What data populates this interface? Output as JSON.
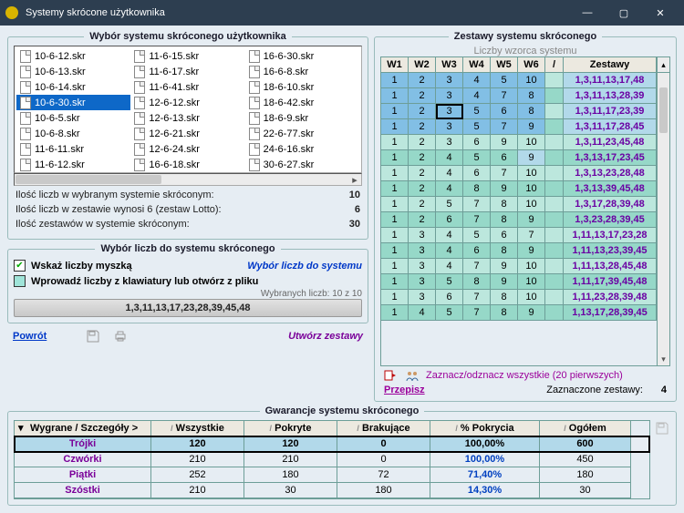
{
  "window": {
    "title": "Systemy skrócone użytkownika"
  },
  "left": {
    "legend": "Wybór systemu skróconego użytkownika",
    "files": [
      "10-6-12.skr",
      "11-6-15.skr",
      "16-6-30.skr",
      "10-6-13.skr",
      "11-6-17.skr",
      "16-6-8.skr",
      "10-6-14.skr",
      "11-6-41.skr",
      "18-6-10.skr",
      "10-6-30.skr",
      "12-6-12.skr",
      "18-6-42.skr",
      "10-6-5.skr",
      "12-6-13.skr",
      "18-6-9.skr",
      "10-6-8.skr",
      "12-6-21.skr",
      "22-6-77.skr",
      "11-6-11.skr",
      "12-6-24.skr",
      "24-6-16.skr",
      "11-6-12.skr",
      "16-6-18.skr",
      "30-6-27.skr"
    ],
    "selected_file": "10-6-30.skr",
    "info": [
      {
        "label": "Ilość liczb w wybranym systemie skróconym:",
        "value": "10"
      },
      {
        "label": "Ilość liczb w zestawie wynosi 6 (zestaw Lotto):",
        "value": "6"
      },
      {
        "label": "Ilość zestawów w systemie skróconym:",
        "value": "30"
      }
    ]
  },
  "picker": {
    "legend": "Wybór liczb do systemu skróconego",
    "opt_mouse": "Wskaż liczby myszką",
    "opt_link": "Wybór liczb do systemu",
    "opt_file": "Wprowadź liczby z klawiatury lub otwórz z pliku",
    "chosen_label": "Wybranych liczb: 10 z 10",
    "chosen_numbers": "1,3,11,13,17,23,28,39,45,48"
  },
  "actions": {
    "back": "Powrót",
    "create": "Utwórz zestawy"
  },
  "sets": {
    "legend": "Zestawy systemu skróconego",
    "pattern": "Liczby wzorca systemu",
    "headers": [
      "W1",
      "W2",
      "W3",
      "W4",
      "W5",
      "W6",
      "/",
      "Zestawy"
    ],
    "rows": [
      {
        "w": [
          1,
          2,
          3,
          4,
          5,
          10
        ],
        "z": "1,3,11,13,17,48",
        "sel": true
      },
      {
        "w": [
          1,
          2,
          3,
          4,
          7,
          8
        ],
        "z": "1,3,11,13,28,39",
        "sel": true
      },
      {
        "w": [
          1,
          2,
          3,
          5,
          6,
          8
        ],
        "z": "1,3,11,17,23,39",
        "sel": true,
        "box": 2
      },
      {
        "w": [
          1,
          2,
          3,
          5,
          7,
          9
        ],
        "z": "1,3,11,17,28,45",
        "sel": true
      },
      {
        "w": [
          1,
          2,
          3,
          6,
          9,
          10
        ],
        "z": "1,3,11,23,45,48"
      },
      {
        "w": [
          1,
          2,
          4,
          5,
          6,
          9
        ],
        "z": "1,3,13,17,23,45",
        "cellsel": 5
      },
      {
        "w": [
          1,
          2,
          4,
          6,
          7,
          10
        ],
        "z": "1,3,13,23,28,48"
      },
      {
        "w": [
          1,
          2,
          4,
          8,
          9,
          10
        ],
        "z": "1,3,13,39,45,48"
      },
      {
        "w": [
          1,
          2,
          5,
          7,
          8,
          10
        ],
        "z": "1,3,17,28,39,48"
      },
      {
        "w": [
          1,
          2,
          6,
          7,
          8,
          9
        ],
        "z": "1,3,23,28,39,45"
      },
      {
        "w": [
          1,
          3,
          4,
          5,
          6,
          7
        ],
        "z": "1,11,13,17,23,28"
      },
      {
        "w": [
          1,
          3,
          4,
          6,
          8,
          9
        ],
        "z": "1,11,13,23,39,45"
      },
      {
        "w": [
          1,
          3,
          4,
          7,
          9,
          10
        ],
        "z": "1,11,13,28,45,48"
      },
      {
        "w": [
          1,
          3,
          5,
          8,
          9,
          10
        ],
        "z": "1,11,17,39,45,48"
      },
      {
        "w": [
          1,
          3,
          6,
          7,
          8,
          10
        ],
        "z": "1,11,23,28,39,48"
      },
      {
        "w": [
          1,
          4,
          5,
          7,
          8,
          9
        ],
        "z": "1,13,17,28,39,45"
      }
    ],
    "mark_all": "Zaznacz/odznacz wszystkie (20 pierwszych)",
    "rewrite": "Przepisz",
    "marked_label": "Zaznaczone zestawy:",
    "marked_value": "4"
  },
  "gw": {
    "legend": "Gwarancje systemu skróconego",
    "headers": [
      "Wygrane / Szczegóły >",
      "Wszystkie",
      "Pokryte",
      "Brakujące",
      "% Pokrycia",
      "Ogółem"
    ],
    "rows": [
      {
        "name": "Trójki",
        "v": [
          "120",
          "120",
          "0",
          "100,00%",
          "600"
        ]
      },
      {
        "name": "Czwórki",
        "v": [
          "210",
          "210",
          "0",
          "100,00%",
          "450"
        ],
        "blue": true
      },
      {
        "name": "Piątki",
        "v": [
          "252",
          "180",
          "72",
          "71,40%",
          "180"
        ],
        "blue": true
      },
      {
        "name": "Szóstki",
        "v": [
          "210",
          "30",
          "180",
          "14,30%",
          "30"
        ],
        "blue": true
      }
    ]
  }
}
